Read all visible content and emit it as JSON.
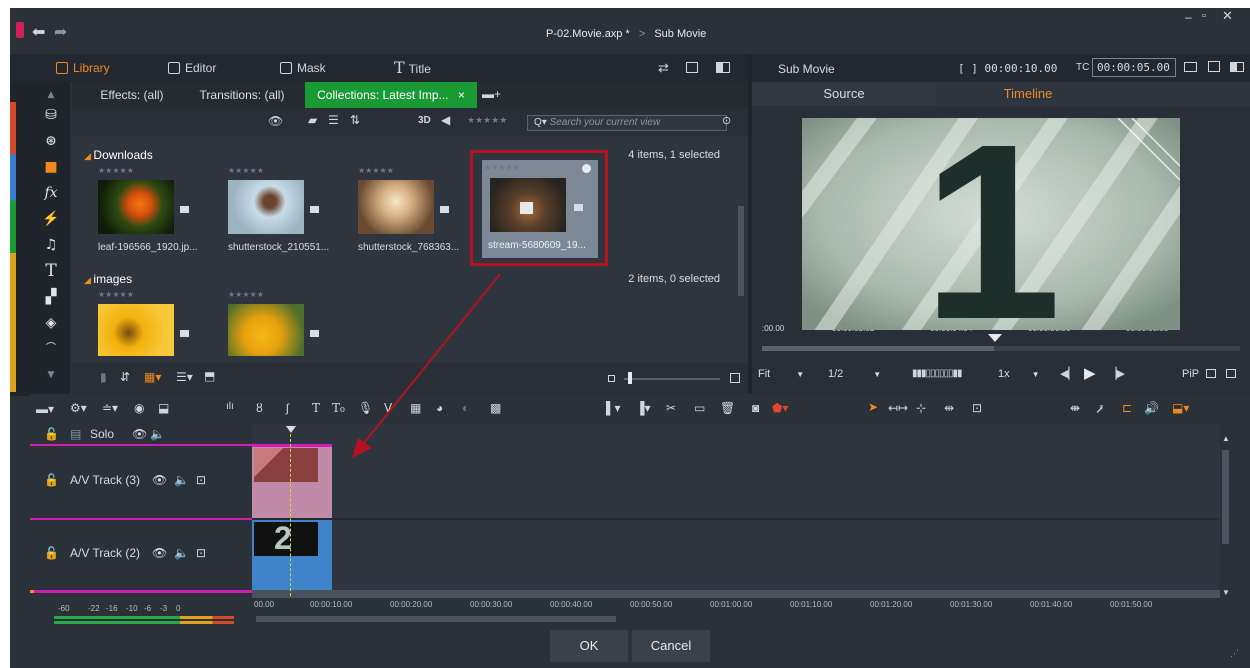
{
  "title": {
    "project": "P-02.Movie.axp *",
    "separator": ">",
    "sub": "Sub Movie"
  },
  "nav_tabs": {
    "library": "Library",
    "editor": "Editor",
    "mask": "Mask",
    "title": "Title"
  },
  "library": {
    "subtabs": {
      "effects": "Effects: (all)",
      "transitions": "Transitions: (all)",
      "collections": "Collections: Latest Imp...",
      "close": "×"
    },
    "toolbar": {
      "three_d": "3D",
      "search_placeholder": "Search your current view"
    },
    "sections": [
      {
        "name": "Downloads",
        "info": "4 items, 1 selected",
        "items": [
          {
            "caption": "leaf-196566_1920.jp...",
            "stars": "★★★★★"
          },
          {
            "caption": "shutterstock_210551...",
            "stars": "★★★★★"
          },
          {
            "caption": "shutterstock_768363...",
            "stars": "★★★★★"
          },
          {
            "caption": "stream-5680609_19...",
            "stars": "★★★★★"
          }
        ]
      },
      {
        "name": "images",
        "info": "2 items, 0 selected",
        "items": [
          {
            "caption": "",
            "stars": "★★★★★"
          },
          {
            "caption": "",
            "stars": "★★★★★"
          }
        ]
      }
    ]
  },
  "preview": {
    "title": "Sub Movie",
    "timecode": "[ ] 00:00:10.00",
    "tc_label": "TC",
    "tc_value": "00:00:05.00",
    "source_tab": "Source",
    "timeline_tab": "Timeline",
    "big_digit": "1",
    "ruler": [
      ":00.00",
      "00:00:02.02",
      "00:00:04.04",
      "00:00:06.06",
      "00:00:08.08"
    ],
    "fit": "Fit",
    "ratio": "1/2",
    "speed": "1x",
    "pip": "PiP"
  },
  "timeline": {
    "solo": "Solo",
    "tracks": [
      {
        "name": "A/V Track (3)"
      },
      {
        "name": "A/V Track (2)",
        "clip_digit": "2"
      }
    ],
    "meter_scale": [
      "-60",
      "-22",
      "-16",
      "-10",
      "-6",
      "-3",
      "0"
    ],
    "ruler": [
      "00.00",
      "00:00:10.00",
      "00:00:20.00",
      "00:00:30.00",
      "00:00:40.00",
      "00:00:50.00",
      "00:01:00.00",
      "00:01:10.00",
      "00:01:20.00",
      "00:01:30.00",
      "00:01:40.00",
      "00:01:50.00"
    ]
  },
  "dialog": {
    "ok": "OK",
    "cancel": "Cancel"
  },
  "colors": {
    "accent_green": "#1a9a35",
    "timeline_orange": "#f08a1c",
    "highlight_red": "#b3121e",
    "track3_clip": "#c08aa8",
    "track2_clip": "#3f84c8"
  }
}
